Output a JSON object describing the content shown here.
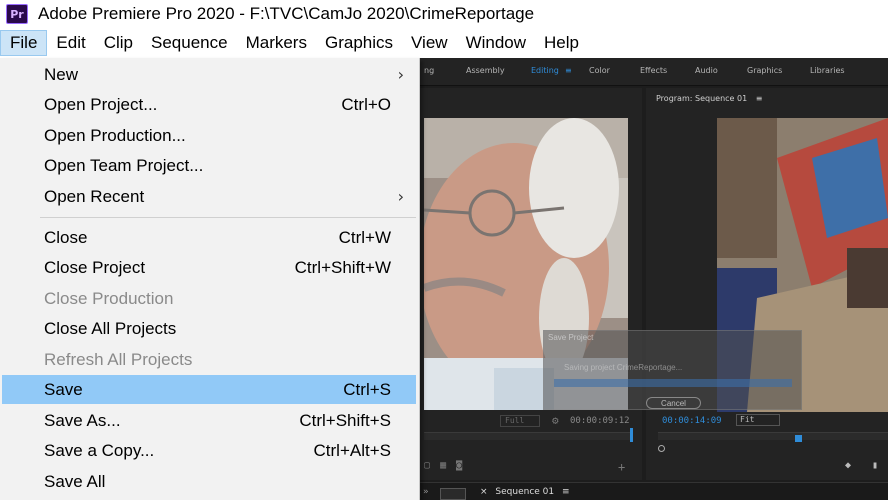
{
  "window": {
    "icon_text": "Pr",
    "title": "Adobe Premiere Pro 2020 - F:\\TVC\\CamJo 2020\\CrimeReportage"
  },
  "menubar": [
    "File",
    "Edit",
    "Clip",
    "Sequence",
    "Markers",
    "Graphics",
    "View",
    "Window",
    "Help"
  ],
  "workspaces": [
    "ng",
    "Assembly",
    "Editing",
    "Color",
    "Effects",
    "Audio",
    "Graphics",
    "Libraries"
  ],
  "workspace_menu_glyph": "≡",
  "file_menu": {
    "items": [
      {
        "label": "New",
        "shortcut": "",
        "submenu": true
      },
      {
        "label": "Open Project...",
        "shortcut": "Ctrl+O"
      },
      {
        "label": "Open Production...",
        "shortcut": ""
      },
      {
        "label": "Open Team Project...",
        "shortcut": ""
      },
      {
        "label": "Open Recent",
        "shortcut": "",
        "submenu": true
      },
      {
        "label": "Close",
        "shortcut": "Ctrl+W"
      },
      {
        "label": "Close Project",
        "shortcut": "Ctrl+Shift+W"
      },
      {
        "label": "Close Production",
        "shortcut": "",
        "disabled": true
      },
      {
        "label": "Close All Projects",
        "shortcut": ""
      },
      {
        "label": "Refresh All Projects",
        "shortcut": "",
        "disabled": true
      },
      {
        "label": "Save",
        "shortcut": "Ctrl+S",
        "highlighted": true
      },
      {
        "label": "Save As...",
        "shortcut": "Ctrl+Shift+S"
      },
      {
        "label": "Save a Copy...",
        "shortcut": "Ctrl+Alt+S"
      },
      {
        "label": "Save All",
        "shortcut": ""
      }
    ],
    "submenu_glyph": "›"
  },
  "program_monitor": {
    "title": "Program: Sequence 01",
    "menu_glyph": "≡",
    "timecode": "00:00:14:09",
    "fit": "Fit"
  },
  "source_monitor": {
    "zoom": "Full",
    "timecode": "00:00:09:12"
  },
  "save_dialog": {
    "title": "Save Project",
    "message": "Saving project CrimeReportage...",
    "cancel": "Cancel"
  },
  "sequence_tab": "Sequence 01",
  "sequence_close_glyph": "×",
  "colors": {
    "accent": "#2f8cd8",
    "highlight": "#91c9f7",
    "menu_active": "#cce4f7"
  }
}
